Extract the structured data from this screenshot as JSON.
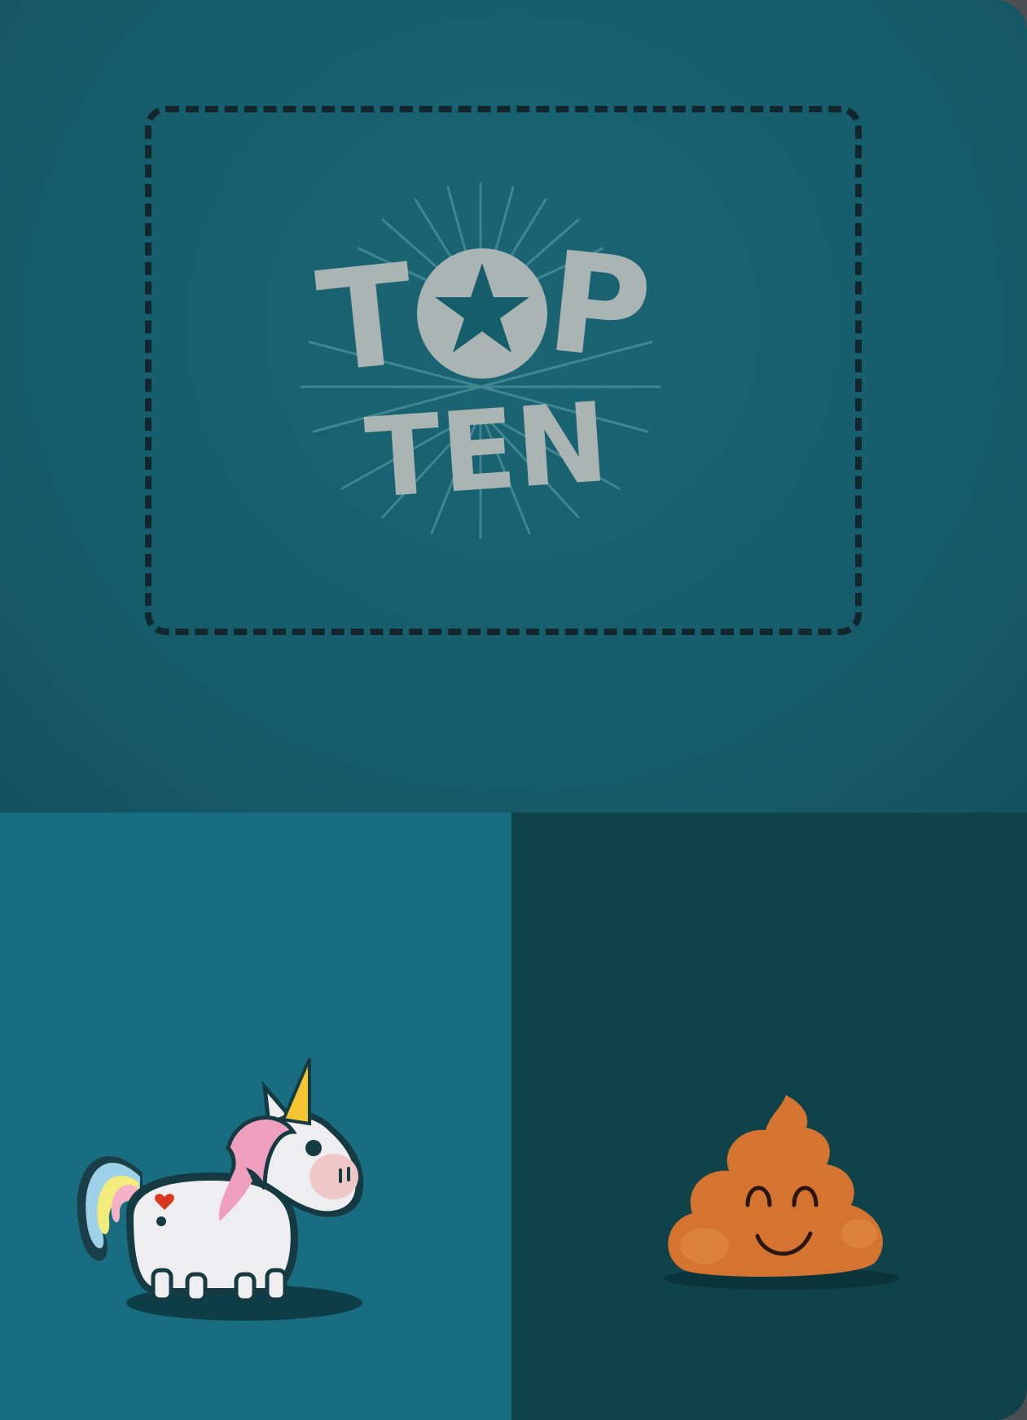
{
  "logo": {
    "line1_left": "T",
    "line1_middle_icon": "star-in-circle-icon",
    "line1_right": "P",
    "line2": "TEN",
    "text_color": "#a9b4b3"
  },
  "panels": {
    "top_color": "#175e6d",
    "bottom_left_color": "#186e80",
    "bottom_right_color": "#0f4249"
  },
  "icons": {
    "left": "unicorn-icon",
    "right": "smiling-poop-icon"
  }
}
